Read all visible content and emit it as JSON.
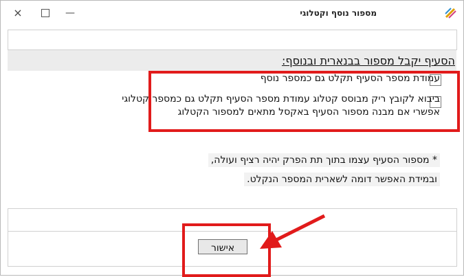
{
  "window": {
    "title": "מספור נוסף וקטלוגי",
    "app_icon": "app-logo-icon",
    "controls": {
      "close": "×",
      "maximize": "☐",
      "minimize": "—"
    }
  },
  "heading": "הסעיף יקבל מספור בבנארית ובנוסף:",
  "options": [
    {
      "label": "עמודת מספר הסעיף תקלט גם כמספר נוסף",
      "checked": false
    },
    {
      "label_line1": "ביבוא לקובץ ריק  מבוסס קטלוג עמודת מספר הסעיף תקלט  גם כמספר קטלוגי",
      "label_line2": "אפשרי אם מבנה מספור הסעיף באקסל מתאים למספור הקטלוג",
      "checked": false
    }
  ],
  "notes": [
    "* מספור הסעיף עצמו בתוך תת הפרק יהיה רציף ועולה,",
    "ובמידת האפשר דומה לשארית המספר הנקלט."
  ],
  "ok_button": "אישור",
  "colors": {
    "highlight": "#e11b1b",
    "note_bg": "#f2f2f2",
    "band": "#ececec"
  }
}
